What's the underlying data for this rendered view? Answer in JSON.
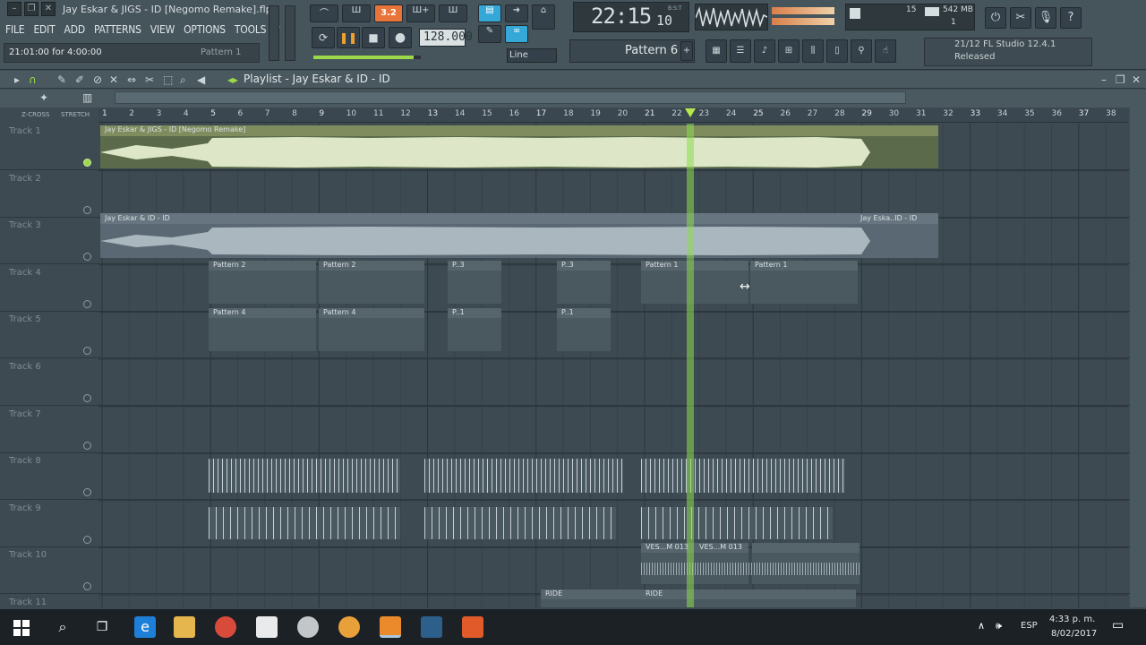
{
  "window": {
    "song_title": "Jay Eskar & JIGS - ID [Negomo Remake].flp",
    "hint": "21:01:00 for 4:00:00",
    "hint_pattern": "Pattern 1"
  },
  "menu": [
    "FILE",
    "EDIT",
    "ADD",
    "PATTERNS",
    "VIEW",
    "OPTIONS",
    "TOOLS",
    "?"
  ],
  "transport": {
    "snap_label": "3.2",
    "bpm": "128.000",
    "snap_mode": "Line",
    "time_main": "22:15",
    "time_small": "10",
    "time_unit": "B:S:T"
  },
  "monitor": {
    "cpu_value": "15",
    "memory": "542 MB",
    "voices": "1"
  },
  "pattern_selector": {
    "label": "Pattern 6"
  },
  "news": {
    "line1": "21/12  FL Studio 12.4.1",
    "line2": "Released"
  },
  "playlist": {
    "title": "Playlist - Jay Eskar & ID - ID",
    "zcross_label": "Z-CROSS",
    "stretch_label": "STRETCH",
    "bars": [
      "1",
      "2",
      "3",
      "4",
      "5",
      "6",
      "7",
      "8",
      "9",
      "10",
      "11",
      "12",
      "13",
      "14",
      "15",
      "16",
      "17",
      "18",
      "19",
      "20",
      "21",
      "22",
      "23",
      "24",
      "25",
      "26",
      "27",
      "28",
      "29",
      "30",
      "31",
      "32",
      "33",
      "34",
      "35",
      "36",
      "37",
      "38"
    ],
    "tracks": [
      "Track 1",
      "Track 2",
      "Track 3",
      "Track 4",
      "Track 5",
      "Track 6",
      "Track 7",
      "Track 8",
      "Track 9",
      "Track 10",
      "Track 11"
    ],
    "clips": {
      "t1_audio": "Jay Eskar & JIGS - ID [Negomo Remake]",
      "t3_audio": "Jay Eskar & ID - ID",
      "t3_audio_end": "Jay Eska..ID - ID",
      "t4_p2a": "Pattern 2",
      "t4_p2b": "Pattern 2",
      "t4_p1a": "Pattern 1",
      "t4_p1b": "Pattern 1",
      "t4_p_small1": "P..3",
      "t4_p_small2": "P..3",
      "t5_p4a": "Pattern 4",
      "t5_p4b": "Pattern 4",
      "t5_p1a": "P..1",
      "t5_p1b": "P..1",
      "t10_ves1": "VES...M 013",
      "t10_ves2": "VES...M 013",
      "t11_ride1": "RIDE",
      "t11_ride2": "RIDE"
    }
  },
  "taskbar": {
    "lang": "ESP",
    "time": "4:33 p. m.",
    "date": "8/02/2017"
  }
}
